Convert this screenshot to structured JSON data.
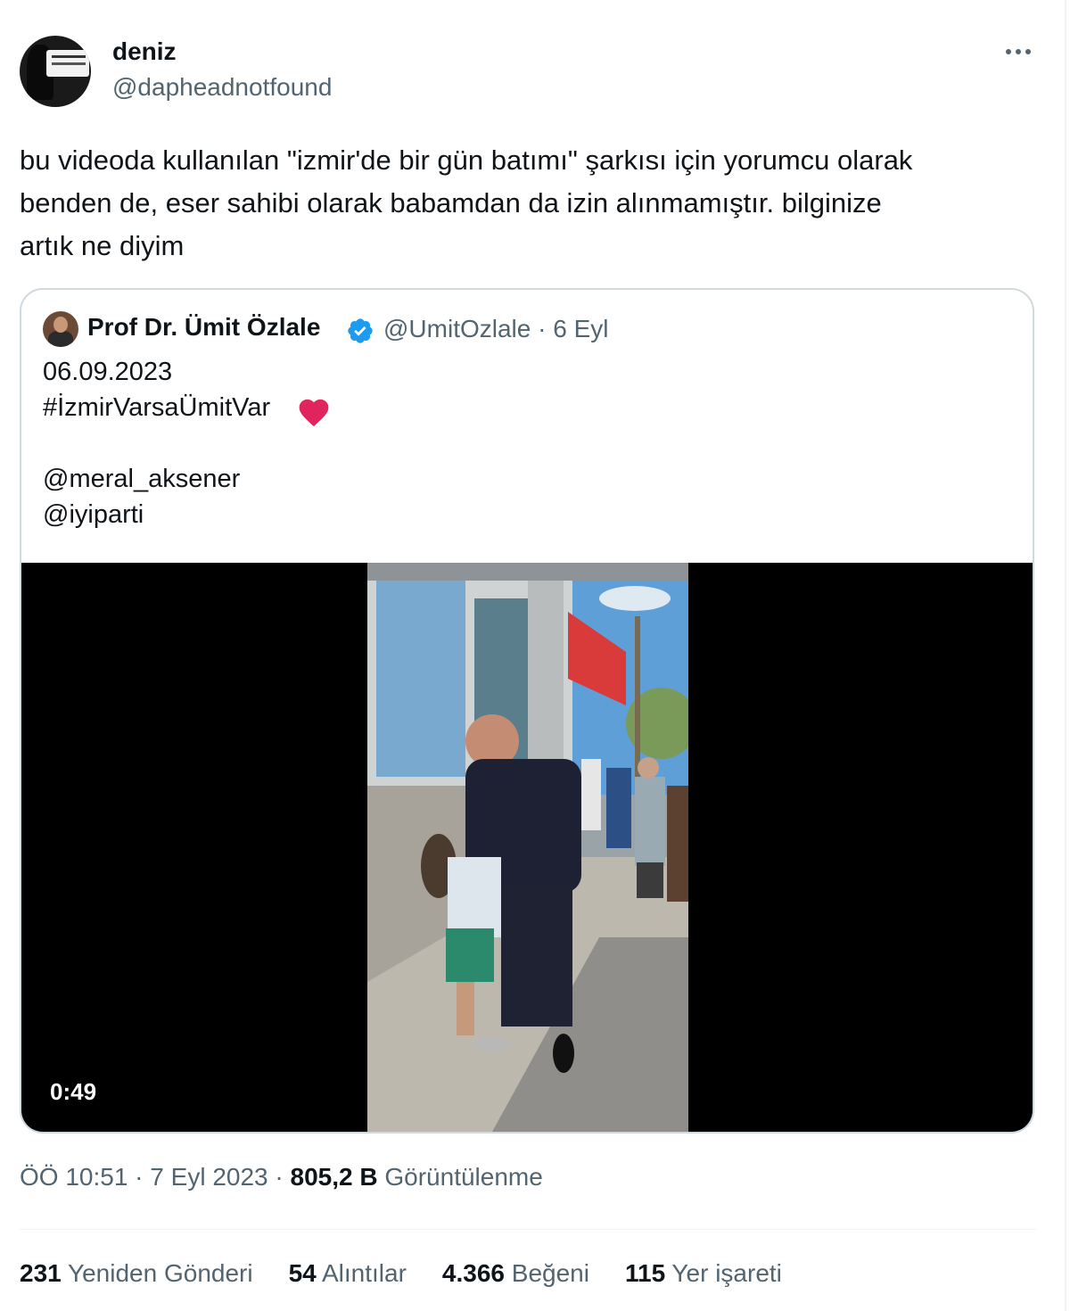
{
  "author": {
    "name": "deniz",
    "handle": "@dapheadnotfound"
  },
  "tweet": {
    "lines": [
      "bu videoda kullanılan \"izmir'de bir gün batımı\" şarkısı için yorumcu olarak",
      "benden de, eser sahibi olarak babamdan da izin alınmamıştır. bilginize",
      "artık ne diyim"
    ]
  },
  "quoted": {
    "name": "Prof Dr. Ümit Özlale",
    "handle": "@UmitOzlale",
    "separator": "·",
    "date": "6 Eyl",
    "lines": [
      "06.09.2023",
      "#İzmirVarsaÜmitVar",
      "@meral_aksener",
      "@iyiparti"
    ],
    "video_duration": "0:49",
    "verified_color": "#1d9bf0"
  },
  "meta": {
    "time": "ÖÖ 10:51",
    "sep1": " · ",
    "date": "7 Eyl 2023",
    "sep2": " · ",
    "views": "805,2 B",
    "views_label": "Görüntülenme"
  },
  "stats": [
    {
      "count": "231",
      "label": "Yeniden Gönderi"
    },
    {
      "count": "54",
      "label": "Alıntılar"
    },
    {
      "count": "4.366",
      "label": "Beğeni"
    },
    {
      "count": "115",
      "label": "Yer işareti"
    }
  ],
  "icons": {
    "more": "more-horizontal-icon",
    "verified": "verified-badge-icon",
    "heart": "red-heart-emoji"
  },
  "colors": {
    "text": "#0f1419",
    "secondary": "#536471",
    "border": "#cfd9de",
    "heart": "#e0245e"
  }
}
